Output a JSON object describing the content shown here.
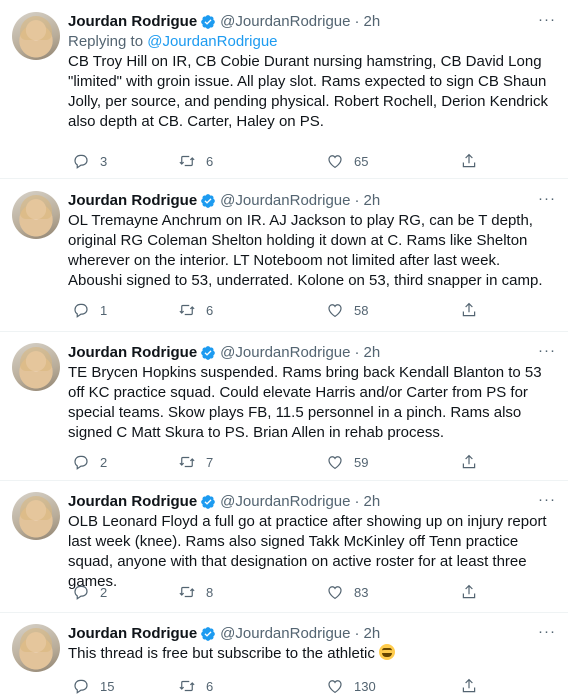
{
  "tweets": [
    {
      "name": "Jourdan Rodrigue",
      "handle": "@JourdanRodrigue",
      "time": "2h",
      "replying_label": "Replying to ",
      "replying_to": "@JourdanRodrigue",
      "text": "CB Troy Hill on IR, CB Cobie Durant nursing hamstring, CB David Long \"limited\" with groin issue. All play slot. Rams expected to sign CB Shaun Jolly, per source, and pending physical. Robert Rochell, Derion Kendrick also depth at CB. Carter, Haley on PS.",
      "replies": "3",
      "retweets": "6",
      "likes": "65"
    },
    {
      "name": "Jourdan Rodrigue",
      "handle": "@JourdanRodrigue",
      "time": "2h",
      "text": "OL Tremayne Anchrum on IR. AJ Jackson to play RG, can be T depth, original RG Coleman Shelton holding it down at C. Rams like Shelton wherever on the interior. LT Noteboom not limited after last week. Aboushi signed to 53, underrated. Kolone on 53, third snapper in camp.",
      "replies": "1",
      "retweets": "6",
      "likes": "58"
    },
    {
      "name": "Jourdan Rodrigue",
      "handle": "@JourdanRodrigue",
      "time": "2h",
      "text": "TE Brycen Hopkins suspended. Rams bring back Kendall Blanton to 53 off KC practice squad. Could elevate Harris and/or Carter from PS for special teams. Skow plays FB, 11.5 personnel in a pinch. Rams also signed C Matt Skura to PS. Brian Allen in rehab process.",
      "replies": "2",
      "retweets": "7",
      "likes": "59"
    },
    {
      "name": "Jourdan Rodrigue",
      "handle": "@JourdanRodrigue",
      "time": "2h",
      "text": "OLB Leonard Floyd a full go at practice after showing up on injury report last week (knee). Rams also signed Takk McKinley off Tenn practice squad, anyone with that designation on active roster for at least three games.",
      "replies": "2",
      "retweets": "8",
      "likes": "83"
    },
    {
      "name": "Jourdan Rodrigue",
      "handle": "@JourdanRodrigue",
      "time": "2h",
      "text": "This thread is free but subscribe to the athletic",
      "emoji": "laughing-face-emoji",
      "replies": "15",
      "retweets": "6",
      "likes": "130"
    }
  ],
  "dot": "·",
  "more": "···",
  "icons": {
    "verified": "verified-badge-icon",
    "reply": "reply-icon",
    "retweet": "retweet-icon",
    "like": "heart-icon",
    "share": "share-icon",
    "more": "more-icon"
  },
  "colors": {
    "text": "#0f1419",
    "muted": "#536471",
    "link": "#1d9bf0",
    "verified": "#1d9bf0",
    "divider": "#eff3f4"
  }
}
